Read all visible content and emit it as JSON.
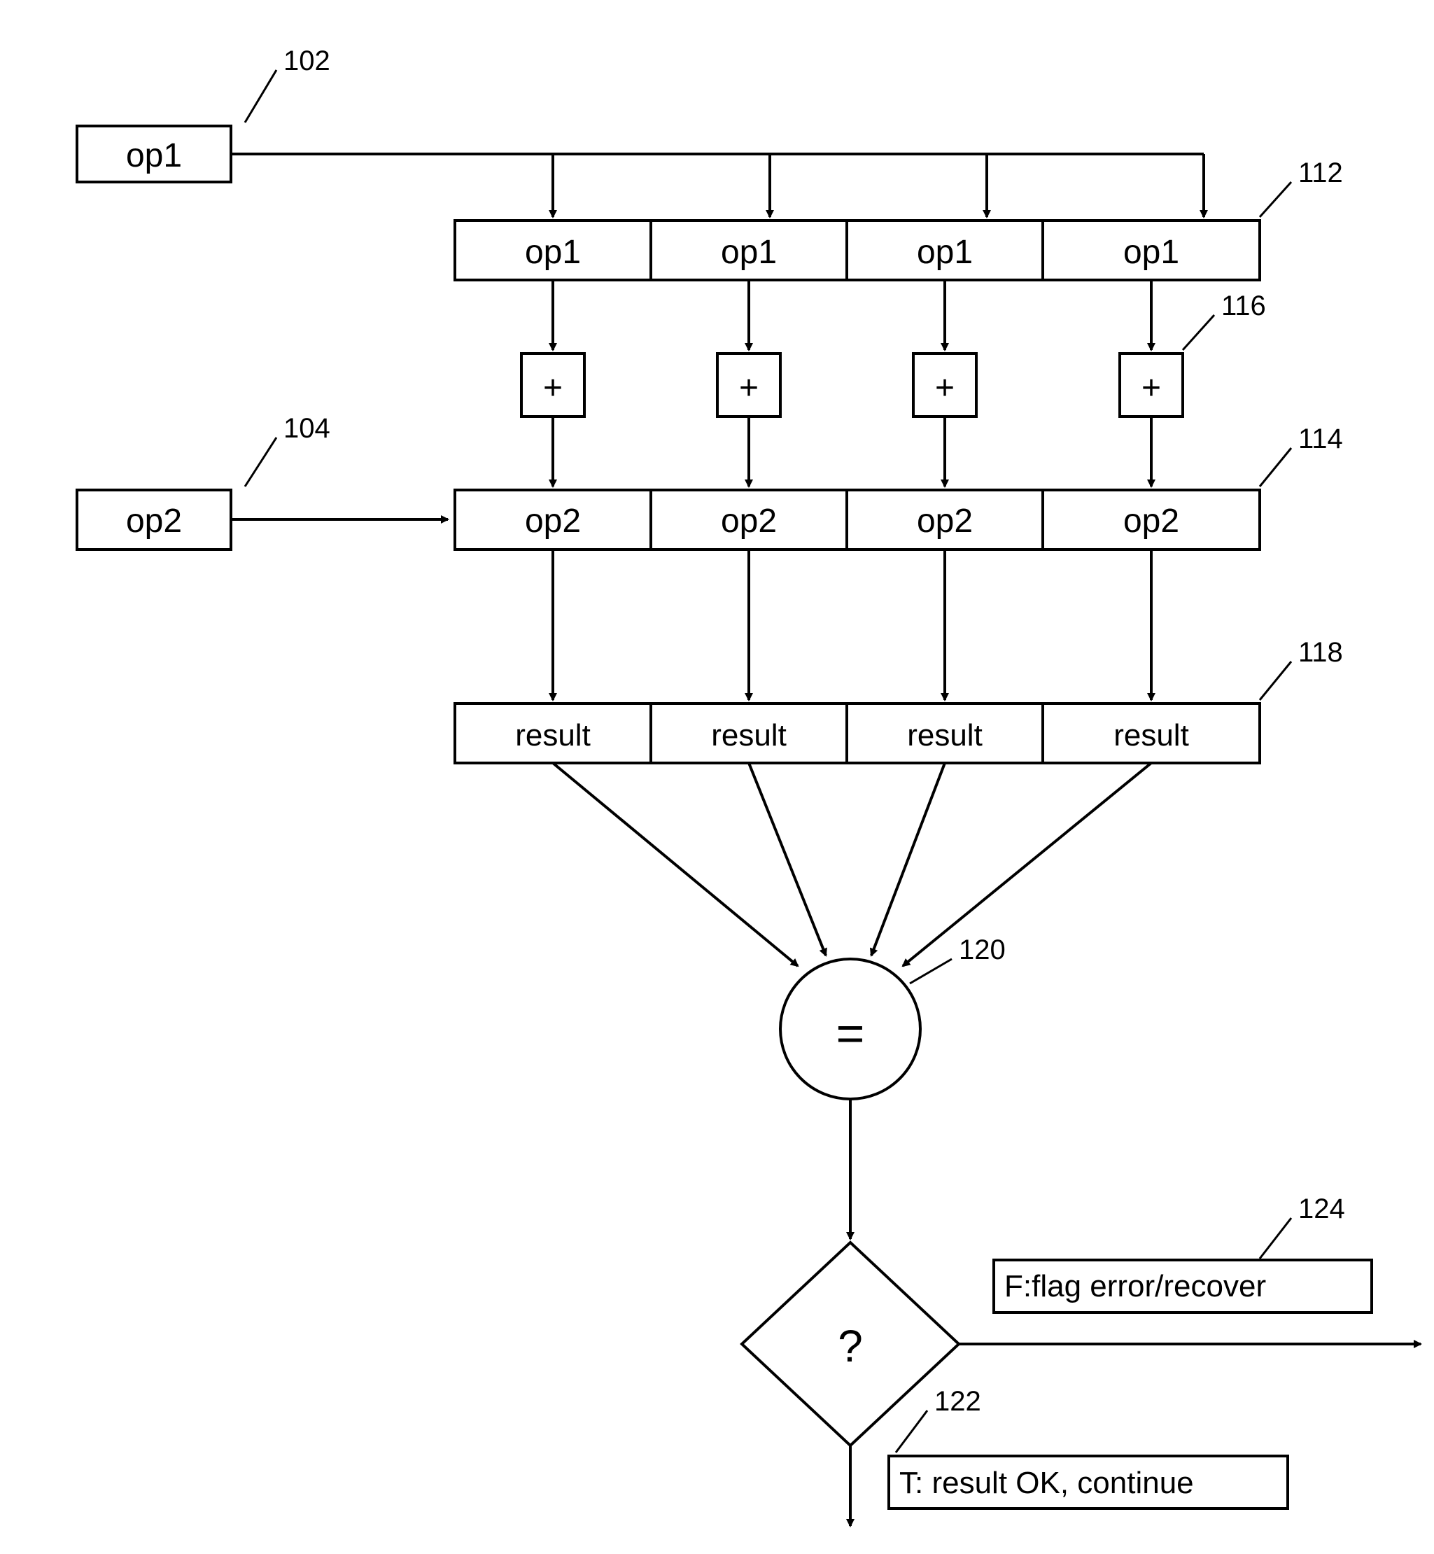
{
  "ref": {
    "n102": "102",
    "n104": "104",
    "n112": "112",
    "n114": "114",
    "n116": "116",
    "n118": "118",
    "n120": "120",
    "n122": "122",
    "n124": "124"
  },
  "labels": {
    "op1": "op1",
    "op2": "op2",
    "plus": "+",
    "result": "result",
    "eq": "=",
    "q": "?",
    "false_label": "F:flag error/recover",
    "true_label": "T: result OK, continue"
  },
  "lanes": {
    "op1_row": [
      "op1",
      "op1",
      "op1",
      "op1"
    ],
    "op2_row": [
      "op2",
      "op2",
      "op2",
      "op2"
    ],
    "result_row": [
      "result",
      "result",
      "result",
      "result"
    ]
  }
}
